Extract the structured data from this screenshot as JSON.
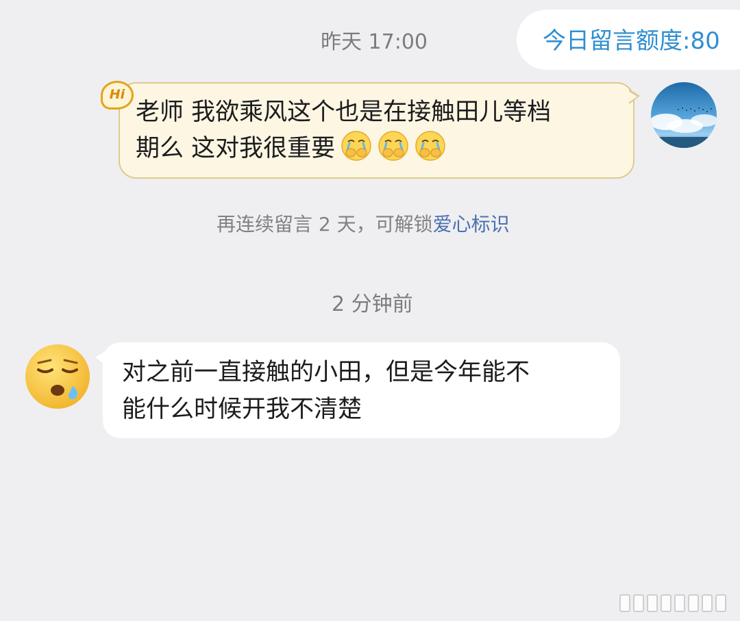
{
  "header": {
    "quota_label": "今日留言额度:80"
  },
  "thread": {
    "timestamp_1": "昨天 17:00",
    "sent_message": {
      "badge": "Hi",
      "line1": "老师 我欲乘风这个也是在接触田儿等档",
      "line2": "期么 这对我很重要",
      "emoji": "crying-covering-mouth-emoji",
      "emoji_count": 3
    },
    "hint": {
      "prefix": "再连续留言 2 天，可解锁",
      "link": "爱心标识"
    },
    "timestamp_2": "2 分钟前",
    "received_message": {
      "line1": "对之前一直接触的小田，但是今年能不",
      "line2": "能什么时候开我不清楚",
      "avatar": "sleepy-face-emoji"
    }
  },
  "colors": {
    "background": "#efeff1",
    "accent_blue": "#2f8fd0",
    "sent_bubble": "#fcf6e3",
    "sent_border": "#dfc98f",
    "link_blue": "#4a6fb0"
  }
}
